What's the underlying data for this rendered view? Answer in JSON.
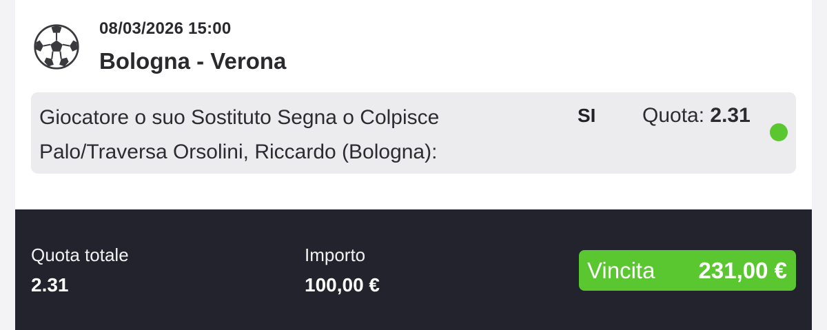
{
  "event": {
    "datetime": "08/03/2026 15:00",
    "match": "Bologna - Verona",
    "sport_icon": "soccer-ball-icon"
  },
  "selection": {
    "description": "Giocatore o suo Sostituto Segna o Colpisce Palo/Traversa Orsolini, Riccardo (Bologna):",
    "choice": "SI",
    "odds_label": "Quota:",
    "odds_value": "2.31",
    "status_color": "#5ac630"
  },
  "summary": {
    "total_odds_label": "Quota totale",
    "total_odds_value": "2.31",
    "stake_label": "Importo",
    "stake_value": "100,00 €",
    "win_label": "Vincita",
    "win_value": "231,00 €"
  },
  "colors": {
    "accent_green": "#5ac630",
    "footer_bg": "#22232d",
    "selection_bg": "#ececee"
  }
}
